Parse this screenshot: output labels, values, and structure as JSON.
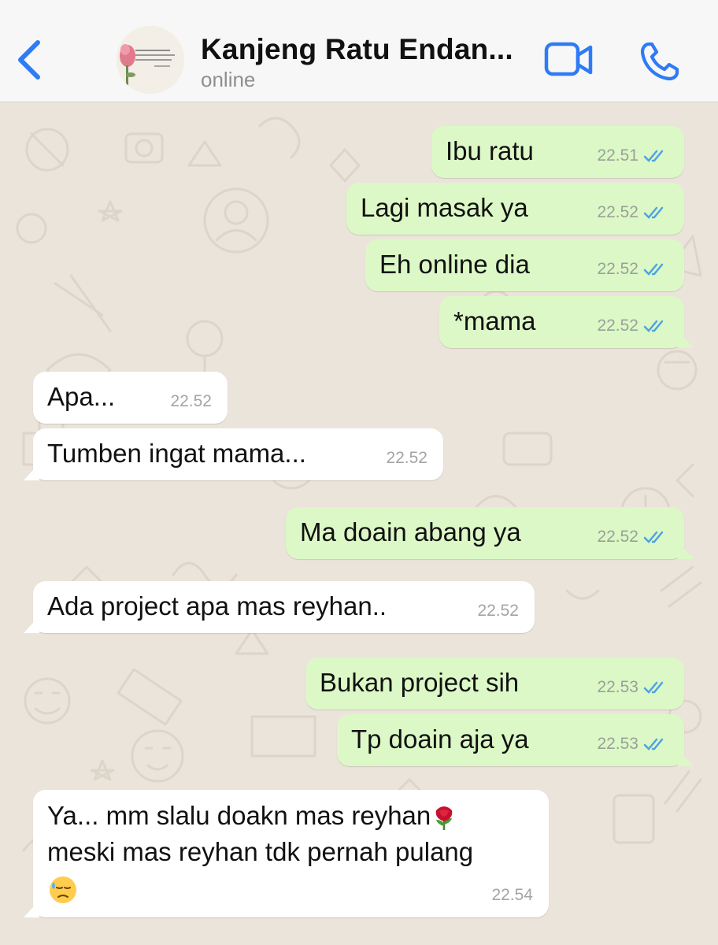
{
  "header": {
    "contact_name": "Kanjeng Ratu Endan...",
    "status": "online",
    "back_icon": "chevron-left-icon",
    "video_icon": "video-camera-icon",
    "call_icon": "phone-icon"
  },
  "colors": {
    "accent": "#2f7bf5",
    "outgoing_bubble": "#dcf8c6",
    "incoming_bubble": "#ffffff",
    "read_ticks": "#4fa3e0",
    "wallpaper": "#ebe4da"
  },
  "messages": [
    {
      "direction": "outgoing",
      "text": "Ibu ratu",
      "time": "22.51",
      "status": "read"
    },
    {
      "direction": "outgoing",
      "text": "Lagi masak ya",
      "time": "22.52",
      "status": "read"
    },
    {
      "direction": "outgoing",
      "text": "Eh online dia",
      "time": "22.52",
      "status": "read"
    },
    {
      "direction": "outgoing",
      "text": "*mama",
      "time": "22.52",
      "status": "read"
    },
    {
      "direction": "incoming",
      "text": "Apa...",
      "time": "22.52"
    },
    {
      "direction": "incoming",
      "text": "Tumben ingat mama...",
      "time": "22.52"
    },
    {
      "direction": "outgoing",
      "text": "Ma doain abang ya",
      "time": "22.52",
      "status": "read"
    },
    {
      "direction": "incoming",
      "text": "Ada project apa mas reyhan..",
      "time": "22.52"
    },
    {
      "direction": "outgoing",
      "text": "Bukan project sih",
      "time": "22.53",
      "status": "read"
    },
    {
      "direction": "outgoing",
      "text": "Tp doain aja ya",
      "time": "22.53",
      "status": "read"
    },
    {
      "direction": "incoming",
      "line1": "Ya... mm slalu doakn mas reyhan",
      "line2": "meski mas reyhan tdk pernah pulang",
      "emoji1": "rose-emoji",
      "emoji2": "downcast-sweat-face-emoji",
      "time": "22.54"
    }
  ]
}
